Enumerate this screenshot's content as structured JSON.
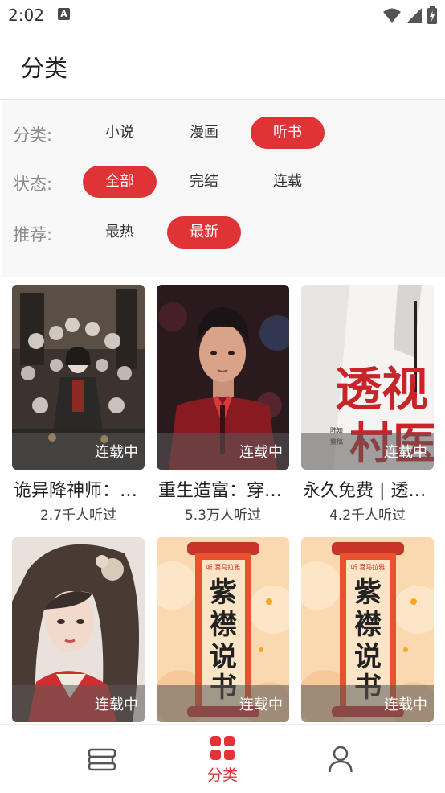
{
  "status_bar": {
    "time": "2:02",
    "notif_badge": "A",
    "icons": [
      "wifi-icon",
      "signal-icon",
      "battery-icon"
    ]
  },
  "header": {
    "title": "分类"
  },
  "filters": {
    "category": {
      "label": "分类:",
      "options": [
        "小说",
        "漫画",
        "听书"
      ],
      "selected": "听书"
    },
    "status": {
      "label": "状态:",
      "options": [
        "全部",
        "完结",
        "连载"
      ],
      "selected": "全部"
    },
    "recommend": {
      "label": "推荐:",
      "options": [
        "最热",
        "最新"
      ],
      "selected": "最新"
    }
  },
  "books": [
    {
      "title": "诡异降神师：…",
      "listens": "2.7千人听过",
      "badge": "连载中"
    },
    {
      "title": "重生造富：穿…",
      "listens": "5.3万人听过",
      "badge": "连载中"
    },
    {
      "title": "永久免费 | 透…",
      "listens": "4.2千人听过",
      "badge": "连载中",
      "cover_text": [
        "透视",
        "村医",
        "陆知",
        "繁稿"
      ]
    },
    {
      "badge": "连载中"
    },
    {
      "badge": "连载中",
      "cover_text": [
        "紫",
        "襟",
        "说",
        "书",
        "听 喜马拉雅"
      ]
    },
    {
      "badge": "连载中",
      "cover_text": [
        "紫",
        "襟",
        "说",
        "书",
        "听 喜马拉雅"
      ]
    }
  ],
  "bottom_nav": {
    "items": [
      {
        "icon": "bookshelf-icon"
      },
      {
        "icon": "category-grid-icon",
        "label": "分类"
      },
      {
        "icon": "profile-icon"
      }
    ]
  },
  "colors": {
    "accent": "#e03336",
    "label_gray": "#8a8a8a",
    "filter_bg": "#f8f8f8"
  }
}
